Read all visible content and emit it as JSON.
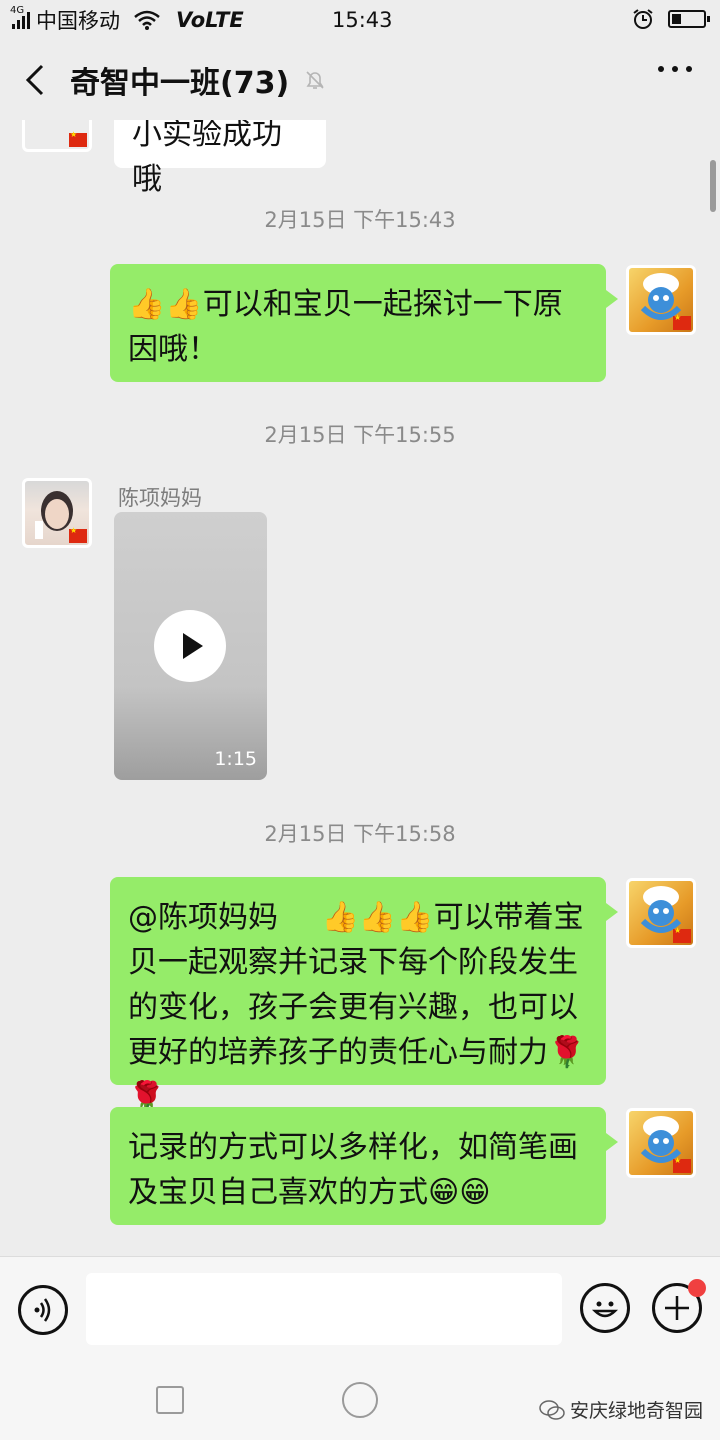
{
  "status_bar": {
    "network_type": "4G",
    "carrier": "中国移动",
    "volte": "VoLTE",
    "time": "15:43",
    "battery_level": 0.3
  },
  "header": {
    "title": "奇智中一班(73)",
    "icons": [
      "back-icon",
      "mute-bell-icon",
      "more-icon"
    ]
  },
  "messages": {
    "top_partial_text": "小实验成功哦",
    "ts1": "2月15日 下午15:43",
    "m1_text": "可以和宝贝一起探讨一下原因哦！",
    "ts2": "2月15日 下午15:55",
    "sender_name": "陈项妈妈",
    "video_duration": "1:15",
    "ts3": "2月15日 下午15:58",
    "m2_mention": "@陈项妈妈",
    "m2_text": "可以带着宝贝一起观察并记录下每个阶段发生的变化，孩子会更有兴趣，也可以更好的培养孩子的责任心与耐力",
    "m3_text": "记录的方式可以多样化，如简笔画及宝贝自己喜欢的方式",
    "emoji_thumbs": "👍",
    "emoji_rose": "🌹",
    "emoji_grin": "😁"
  },
  "input_bar": {
    "placeholder": "",
    "icons": [
      "voice-icon",
      "emoji-icon",
      "plus-icon"
    ]
  },
  "nav_bar": {
    "watermark": "安庆绿地奇智园"
  },
  "colors": {
    "chat_bg": "#ededed",
    "bubble_green": "#95ec69",
    "bubble_white": "#ffffff",
    "timestamp": "#8a8a8a",
    "badge_red": "#f04040"
  }
}
